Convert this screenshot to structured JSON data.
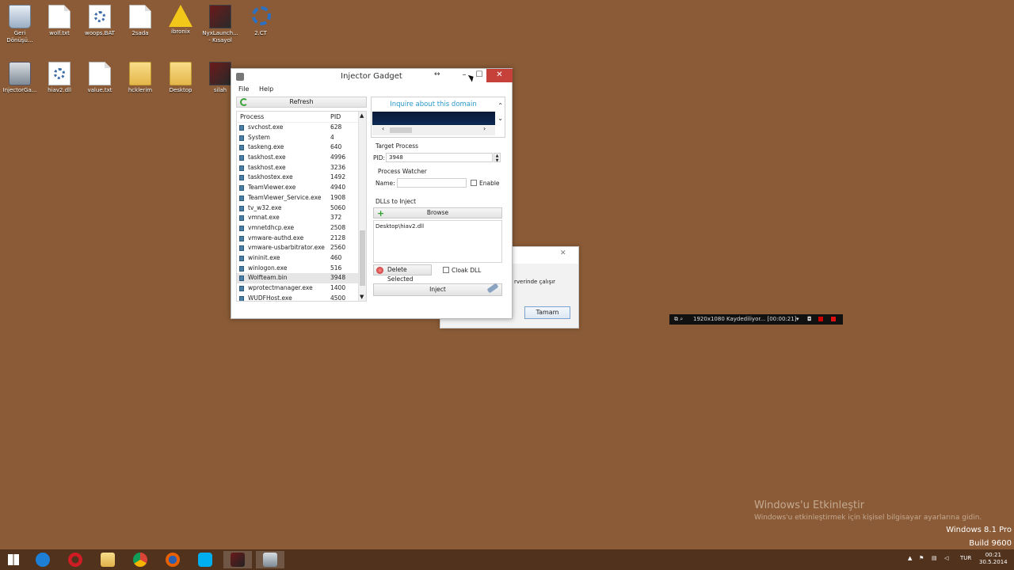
{
  "desktop": {
    "icons": [
      {
        "label": "Geri Dönüşü...",
        "icon": "recycle-bin-icon"
      },
      {
        "label": "wolf.txt",
        "icon": "text-file-icon"
      },
      {
        "label": "woops.BAT",
        "icon": "batch-file-icon"
      },
      {
        "label": "2sada",
        "icon": "blank-file-icon"
      },
      {
        "label": "ibronix",
        "icon": "warning-icon"
      },
      {
        "label": "NyxLaunch... - Kısayol",
        "icon": "game-shortcut-icon"
      },
      {
        "label": "2.CT",
        "icon": "cheat-engine-icon"
      },
      {
        "label": "InjectorGa...",
        "icon": "injector-gadget-icon"
      },
      {
        "label": "hiav2.dll",
        "icon": "dll-file-icon"
      },
      {
        "label": "value.txt",
        "icon": "text-file-icon"
      },
      {
        "label": "hcklerim",
        "icon": "folder-icon"
      },
      {
        "label": "Desktop",
        "icon": "folder-icon"
      },
      {
        "label": "silah",
        "icon": "app-shortcut-icon"
      }
    ]
  },
  "window": {
    "title": "Injector Gadget",
    "menu": [
      "File",
      "Help"
    ],
    "refresh_label": "Refresh",
    "process_list": {
      "headers": {
        "process": "Process",
        "pid": "PID"
      },
      "rows": [
        {
          "name": "svchost.exe",
          "pid": "628"
        },
        {
          "name": "System",
          "pid": "4"
        },
        {
          "name": "taskeng.exe",
          "pid": "640"
        },
        {
          "name": "taskhost.exe",
          "pid": "4996"
        },
        {
          "name": "taskhost.exe",
          "pid": "3236"
        },
        {
          "name": "taskhostex.exe",
          "pid": "1492"
        },
        {
          "name": "TeamViewer.exe",
          "pid": "4940"
        },
        {
          "name": "TeamViewer_Service.exe",
          "pid": "1908"
        },
        {
          "name": "tv_w32.exe",
          "pid": "5060"
        },
        {
          "name": "vmnat.exe",
          "pid": "372"
        },
        {
          "name": "vmnetdhcp.exe",
          "pid": "2508"
        },
        {
          "name": "vmware-authd.exe",
          "pid": "2128"
        },
        {
          "name": "vmware-usbarbitrator.exe",
          "pid": "2560"
        },
        {
          "name": "wininit.exe",
          "pid": "460"
        },
        {
          "name": "winlogon.exe",
          "pid": "516"
        },
        {
          "name": "Wolfteam.bin",
          "pid": "3948"
        },
        {
          "name": "wprotectmanager.exe",
          "pid": "1400"
        },
        {
          "name": "WUDFHost.exe",
          "pid": "4500"
        }
      ],
      "selected_index": 15
    },
    "ad_link": "Inquire about this domain",
    "target_process": {
      "section_label": "Target Process",
      "pid_label": "PID:",
      "pid_value": "3948"
    },
    "process_watcher": {
      "section_label": "Process Watcher",
      "name_label": "Name:",
      "name_value": "",
      "enable_label": "Enable"
    },
    "dlls": {
      "section_label": "DLLs to Inject",
      "browse_label": "Browse",
      "items": [
        "Desktop\\hiav2.dll"
      ],
      "delete_label": "Delete Selected",
      "cloak_label": "Cloak DLL"
    },
    "inject_label": "Inject"
  },
  "dialog": {
    "message_fragment": "rverinde çalışır",
    "ok_label": "Tamam"
  },
  "recorder": {
    "resolution": "1920x1080",
    "status": "Kaydediliyor... [00:00:21]"
  },
  "watermark": {
    "title": "Windows'u Etkinleştir",
    "subtitle": "Windows'u etkinleştirmek için kişisel bilgisayar ayarlarına gidin.",
    "edition": "Windows 8.1 Pro",
    "build": "Build 9600"
  },
  "taskbar": {
    "apps": [
      "start",
      "internet-explorer",
      "opera",
      "file-explorer",
      "chrome",
      "firefox",
      "skype",
      "wolfteam",
      "injector-gadget"
    ],
    "language": "TUR",
    "time": "00:21",
    "date": "30.5.2014"
  },
  "colors": {
    "desktop_bg": "#8a5b36",
    "close_red": "#c7413b",
    "link_blue": "#2a98c8"
  }
}
